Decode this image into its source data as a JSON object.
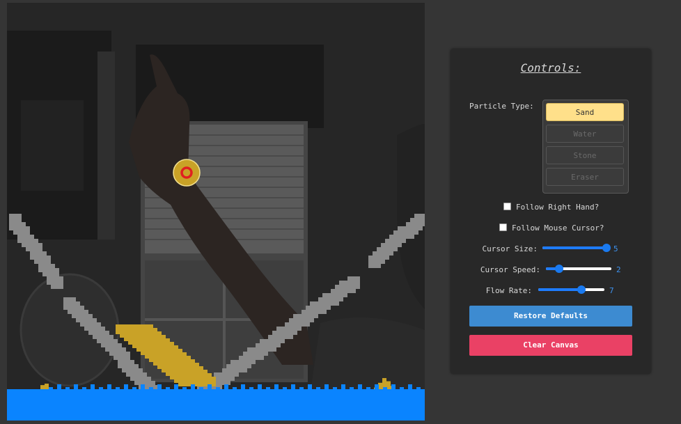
{
  "panel": {
    "title": "Controls:",
    "particle_type_label": "Particle Type:",
    "particle_types": [
      {
        "label": "Sand",
        "active": true
      },
      {
        "label": "Water",
        "active": false
      },
      {
        "label": "Stone",
        "active": false
      },
      {
        "label": "Eraser",
        "active": false
      }
    ],
    "follow_right_hand": {
      "label": "Follow Right Hand?",
      "checked": false
    },
    "follow_mouse": {
      "label": "Follow Mouse Cursor?",
      "checked": false
    },
    "sliders": {
      "cursor_size": {
        "label": "Cursor Size:",
        "value": "5",
        "fraction": 1.0
      },
      "cursor_speed": {
        "label": "Cursor Speed:",
        "value": "2",
        "fraction": 0.2
      },
      "flow_rate": {
        "label": "Flow Rate:",
        "value": "7",
        "fraction": 0.65
      }
    },
    "restore_label": "Restore Defaults",
    "clear_label": "Clear Canvas"
  },
  "colors": {
    "sand": "#c9a227",
    "water": "#0a84ff",
    "stone": "#8a8a8a",
    "restore_button": "#3d8bd1",
    "clear_button": "#ea4165",
    "cursor_ring": "#e02020",
    "cursor_fill": "#c9a227"
  },
  "icons": {
    "cursor": "hand-cursor-icon"
  }
}
